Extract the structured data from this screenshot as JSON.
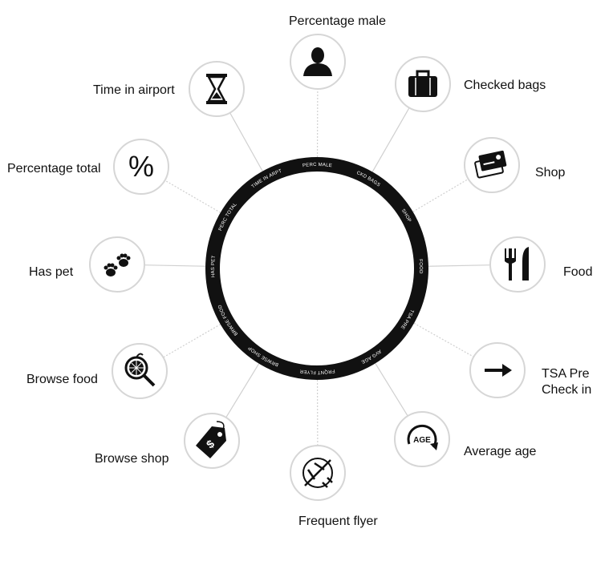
{
  "items": [
    {
      "key": "percentage_male",
      "label": "Percentage male",
      "ring": "PERC MALE",
      "icon": "person-icon"
    },
    {
      "key": "checked_bags",
      "label": "Checked bags",
      "ring": "CKD BAGS",
      "icon": "suitcase-icon"
    },
    {
      "key": "shop",
      "label": "Shop",
      "ring": "SHOP",
      "icon": "credit-card-icon"
    },
    {
      "key": "food",
      "label": "Food",
      "ring": "FOOD",
      "icon": "fork-knife-icon"
    },
    {
      "key": "tsa_pre",
      "label": "TSA Pre Check in",
      "label_lines": [
        "TSA Pre",
        "Check in"
      ],
      "ring": "TSA PRE",
      "icon": "arrow-right-icon"
    },
    {
      "key": "average_age",
      "label": "Average age",
      "ring": "AVG AGE",
      "icon": "age-icon",
      "icon_text": "AGE"
    },
    {
      "key": "frequent_flyer",
      "label": "Frequent flyer",
      "ring": "FRQNT FLYER",
      "icon": "airplane-icon"
    },
    {
      "key": "browse_shop",
      "label": "Browse shop",
      "ring": "BRWSE SHOP",
      "icon": "price-tag-icon"
    },
    {
      "key": "browse_food",
      "label": "Browse food",
      "ring": "BRWSE FOOD",
      "icon": "magnifier-fruit-icon"
    },
    {
      "key": "has_pet",
      "label": "Has pet",
      "ring": "HAS PET",
      "icon": "paw-prints-icon"
    },
    {
      "key": "percentage_total",
      "label": "Percentage total",
      "ring": "PERC TOTAL",
      "icon": "percent-icon",
      "icon_text": "%"
    },
    {
      "key": "time_in_airport",
      "label": "Time in airport",
      "ring": "TIME IN ARPT",
      "icon": "hourglass-icon"
    }
  ],
  "colors": {
    "ring": "#111111",
    "spoke": "#d0d0d0",
    "icon_border": "#d6d6d6",
    "icon": "#111111"
  }
}
